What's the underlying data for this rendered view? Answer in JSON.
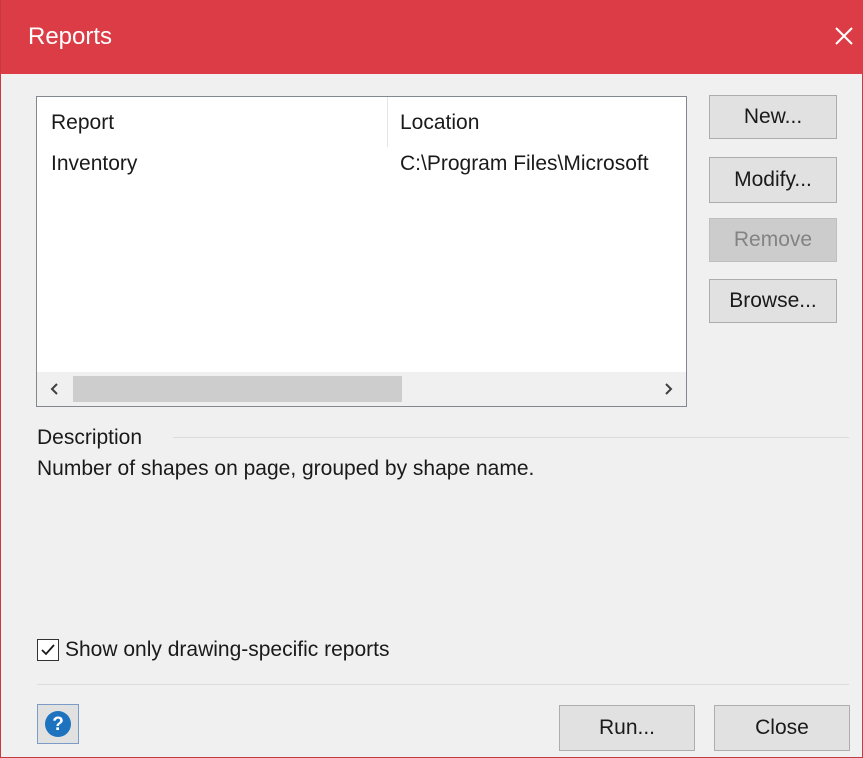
{
  "window": {
    "title": "Reports"
  },
  "list": {
    "columns": [
      "Report",
      "Location"
    ],
    "rows": [
      {
        "report": "Inventory",
        "location": "C:\\Program Files\\Microsoft"
      }
    ]
  },
  "buttons": {
    "new": "New...",
    "modify": "Modify...",
    "remove": "Remove",
    "browse": "Browse...",
    "run": "Run...",
    "close": "Close"
  },
  "description": {
    "label": "Description",
    "text": "Number of shapes on page, grouped by shape name."
  },
  "options": {
    "show_only_drawing_specific": {
      "label": "Show only drawing-specific reports",
      "checked": true
    }
  },
  "colors": {
    "titlebar": "#dc3c46",
    "help_icon": "#1e73be",
    "disabled_text": "#838383"
  },
  "icons": {
    "close": "close-icon",
    "help": "help-icon",
    "scroll_left": "chevron-left-icon",
    "scroll_right": "chevron-right-icon",
    "checkmark": "checkmark-icon"
  }
}
